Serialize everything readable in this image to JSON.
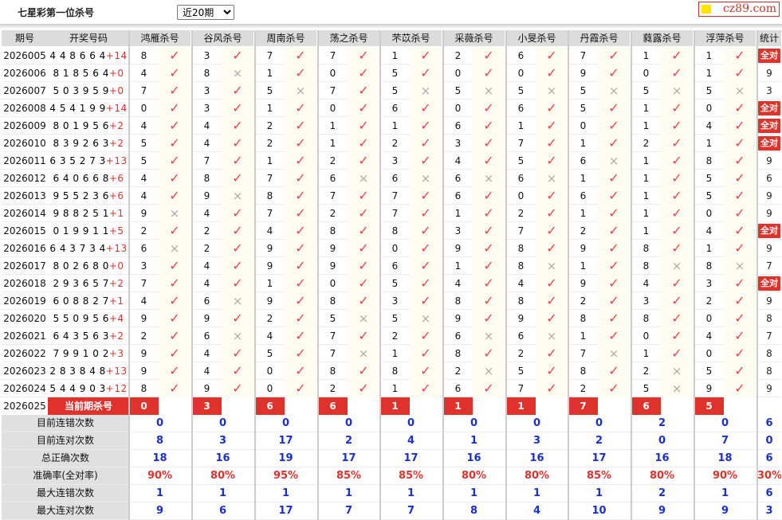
{
  "header": {
    "title": "七星彩第一位杀号",
    "range_select": {
      "selected": "近20期"
    },
    "logo_text": "cz89.com"
  },
  "columns": {
    "period": "期号",
    "numbers": "开奖号码",
    "experts": [
      "鸿雁杀号",
      "谷风杀号",
      "周南杀号",
      "荡之杀号",
      "芣苡杀号",
      "采薇杀号",
      "小旻杀号",
      "丹霞杀号",
      "蕤露杀号",
      "浮萍杀号"
    ],
    "stat": "统计"
  },
  "rows": [
    {
      "period": "2026005",
      "numbers": "448664",
      "sum": "+14",
      "kills": [
        "8",
        "3",
        "7",
        "7",
        "1",
        "2",
        "6",
        "7",
        "1",
        "1"
      ],
      "ok": [
        1,
        1,
        1,
        1,
        1,
        1,
        1,
        1,
        1,
        1
      ],
      "stat": "全对"
    },
    {
      "period": "2026006",
      "numbers": "818564",
      "sum": "+0",
      "kills": [
        "4",
        "8",
        "1",
        "0",
        "5",
        "0",
        "0",
        "9",
        "0",
        "1"
      ],
      "ok": [
        1,
        0,
        1,
        1,
        1,
        1,
        1,
        1,
        1,
        1
      ],
      "stat": "9"
    },
    {
      "period": "2026007",
      "numbers": "503959",
      "sum": "+0",
      "kills": [
        "7",
        "3",
        "5",
        "7",
        "5",
        "5",
        "5",
        "5",
        "5",
        "5"
      ],
      "ok": [
        1,
        1,
        0,
        1,
        0,
        0,
        0,
        0,
        0,
        0
      ],
      "stat": "3"
    },
    {
      "period": "2026008",
      "numbers": "454199",
      "sum": "+14",
      "kills": [
        "0",
        "3",
        "1",
        "0",
        "6",
        "0",
        "6",
        "5",
        "1",
        "0"
      ],
      "ok": [
        1,
        1,
        1,
        1,
        1,
        1,
        1,
        1,
        1,
        1
      ],
      "stat": "全对"
    },
    {
      "period": "2026009",
      "numbers": "801956",
      "sum": "+2",
      "kills": [
        "4",
        "4",
        "2",
        "1",
        "1",
        "6",
        "1",
        "0",
        "1",
        "4"
      ],
      "ok": [
        1,
        1,
        1,
        1,
        1,
        1,
        1,
        1,
        1,
        1
      ],
      "stat": "全对"
    },
    {
      "period": "2026010",
      "numbers": "839263",
      "sum": "+2",
      "kills": [
        "5",
        "4",
        "2",
        "1",
        "2",
        "3",
        "7",
        "1",
        "2",
        "1"
      ],
      "ok": [
        1,
        1,
        1,
        1,
        1,
        1,
        1,
        1,
        1,
        1
      ],
      "stat": "全对"
    },
    {
      "period": "2026011",
      "numbers": "635273",
      "sum": "+13",
      "kills": [
        "5",
        "7",
        "1",
        "2",
        "3",
        "4",
        "5",
        "6",
        "1",
        "8"
      ],
      "ok": [
        1,
        1,
        1,
        1,
        1,
        1,
        1,
        0,
        1,
        1
      ],
      "stat": "9"
    },
    {
      "period": "2026012",
      "numbers": "640668",
      "sum": "+6",
      "kills": [
        "4",
        "8",
        "7",
        "6",
        "6",
        "6",
        "6",
        "1",
        "1",
        "5"
      ],
      "ok": [
        1,
        1,
        1,
        0,
        0,
        0,
        0,
        1,
        1,
        1
      ],
      "stat": "6"
    },
    {
      "period": "2026013",
      "numbers": "955236",
      "sum": "+6",
      "kills": [
        "4",
        "9",
        "8",
        "7",
        "7",
        "6",
        "0",
        "6",
        "1",
        "5"
      ],
      "ok": [
        1,
        0,
        1,
        1,
        1,
        1,
        1,
        1,
        1,
        1
      ],
      "stat": "9"
    },
    {
      "period": "2026014",
      "numbers": "988251",
      "sum": "+1",
      "kills": [
        "9",
        "4",
        "7",
        "2",
        "7",
        "1",
        "2",
        "1",
        "1",
        "0"
      ],
      "ok": [
        0,
        1,
        1,
        1,
        1,
        1,
        1,
        1,
        1,
        1
      ],
      "stat": "9"
    },
    {
      "period": "2026015",
      "numbers": "019911",
      "sum": "+5",
      "kills": [
        "2",
        "2",
        "4",
        "8",
        "8",
        "3",
        "7",
        "2",
        "1",
        "4"
      ],
      "ok": [
        1,
        1,
        1,
        1,
        1,
        1,
        1,
        1,
        1,
        1
      ],
      "stat": "全对"
    },
    {
      "period": "2026016",
      "numbers": "643734",
      "sum": "+13",
      "kills": [
        "6",
        "2",
        "9",
        "9",
        "0",
        "9",
        "8",
        "9",
        "8",
        "1"
      ],
      "ok": [
        0,
        1,
        1,
        1,
        1,
        1,
        1,
        1,
        1,
        1
      ],
      "stat": "9"
    },
    {
      "period": "2026017",
      "numbers": "802680",
      "sum": "+0",
      "kills": [
        "3",
        "4",
        "9",
        "9",
        "6",
        "1",
        "8",
        "1",
        "8",
        "8"
      ],
      "ok": [
        1,
        1,
        1,
        1,
        1,
        1,
        0,
        1,
        0,
        0
      ],
      "stat": "7"
    },
    {
      "period": "2026018",
      "numbers": "293657",
      "sum": "+2",
      "kills": [
        "7",
        "4",
        "1",
        "0",
        "5",
        "4",
        "4",
        "9",
        "4",
        "3"
      ],
      "ok": [
        1,
        1,
        1,
        1,
        1,
        1,
        1,
        1,
        1,
        1
      ],
      "stat": "全对"
    },
    {
      "period": "2026019",
      "numbers": "608827",
      "sum": "+1",
      "kills": [
        "4",
        "6",
        "9",
        "8",
        "3",
        "8",
        "8",
        "2",
        "3",
        "2"
      ],
      "ok": [
        1,
        0,
        1,
        1,
        1,
        1,
        1,
        1,
        1,
        1
      ],
      "stat": "9"
    },
    {
      "period": "2026020",
      "numbers": "550956",
      "sum": "+4",
      "kills": [
        "9",
        "9",
        "2",
        "5",
        "5",
        "9",
        "9",
        "8",
        "8",
        "0"
      ],
      "ok": [
        1,
        1,
        1,
        0,
        0,
        1,
        1,
        1,
        1,
        1
      ],
      "stat": "8"
    },
    {
      "period": "2026021",
      "numbers": "643563",
      "sum": "+2",
      "kills": [
        "2",
        "6",
        "4",
        "7",
        "2",
        "6",
        "6",
        "1",
        "0",
        "4"
      ],
      "ok": [
        1,
        0,
        1,
        1,
        1,
        0,
        0,
        1,
        1,
        1
      ],
      "stat": "7"
    },
    {
      "period": "2026022",
      "numbers": "799102",
      "sum": "+3",
      "kills": [
        "9",
        "4",
        "5",
        "7",
        "1",
        "8",
        "2",
        "7",
        "1",
        "0"
      ],
      "ok": [
        1,
        1,
        1,
        0,
        1,
        1,
        1,
        0,
        1,
        1
      ],
      "stat": "8"
    },
    {
      "period": "2026023",
      "numbers": "283848",
      "sum": "+13",
      "kills": [
        "9",
        "4",
        "0",
        "8",
        "8",
        "2",
        "5",
        "8",
        "2",
        "5"
      ],
      "ok": [
        1,
        1,
        1,
        1,
        1,
        0,
        1,
        1,
        0,
        1
      ],
      "stat": "8"
    },
    {
      "period": "2026024",
      "numbers": "544903",
      "sum": "+12",
      "kills": [
        "8",
        "9",
        "0",
        "2",
        "1",
        "6",
        "7",
        "2",
        "5",
        "9"
      ],
      "ok": [
        1,
        1,
        1,
        1,
        1,
        1,
        1,
        1,
        0,
        1
      ],
      "stat": "9"
    }
  ],
  "current": {
    "period": "2026025",
    "label": "当前期杀号",
    "kills": [
      "0",
      "3",
      "6",
      "6",
      "1",
      "1",
      "1",
      "7",
      "6",
      "5"
    ]
  },
  "summary": [
    {
      "label": "目前连错次数",
      "values": [
        "0",
        "0",
        "0",
        "0",
        "0",
        "0",
        "0",
        "0",
        "2",
        "0"
      ],
      "stat": "6",
      "red": false
    },
    {
      "label": "目前连对次数",
      "values": [
        "8",
        "3",
        "17",
        "2",
        "4",
        "1",
        "3",
        "2",
        "0",
        "7"
      ],
      "stat": "0",
      "red": false
    },
    {
      "label": "总正确次数",
      "values": [
        "18",
        "16",
        "19",
        "17",
        "17",
        "16",
        "16",
        "17",
        "16",
        "18"
      ],
      "stat": "6",
      "red": false
    },
    {
      "label": "准确率(全对率)",
      "values": [
        "90%",
        "80%",
        "95%",
        "85%",
        "85%",
        "80%",
        "80%",
        "85%",
        "80%",
        "90%"
      ],
      "stat": "30%",
      "red": true
    },
    {
      "label": "最大连错次数",
      "values": [
        "1",
        "1",
        "1",
        "1",
        "1",
        "1",
        "1",
        "1",
        "2",
        "1"
      ],
      "stat": "6",
      "red": false
    },
    {
      "label": "最大连对次数",
      "values": [
        "9",
        "6",
        "17",
        "7",
        "7",
        "8",
        "4",
        "10",
        "9",
        "9"
      ],
      "stat": "3",
      "red": false
    }
  ],
  "colors": {
    "accent_red": "#e0322d",
    "check": "#e8434a",
    "blue": "#1a2fd1",
    "header_bg": "#dcdcdc"
  },
  "icons": {
    "ok": "check-icon",
    "ng": "cross-icon"
  }
}
